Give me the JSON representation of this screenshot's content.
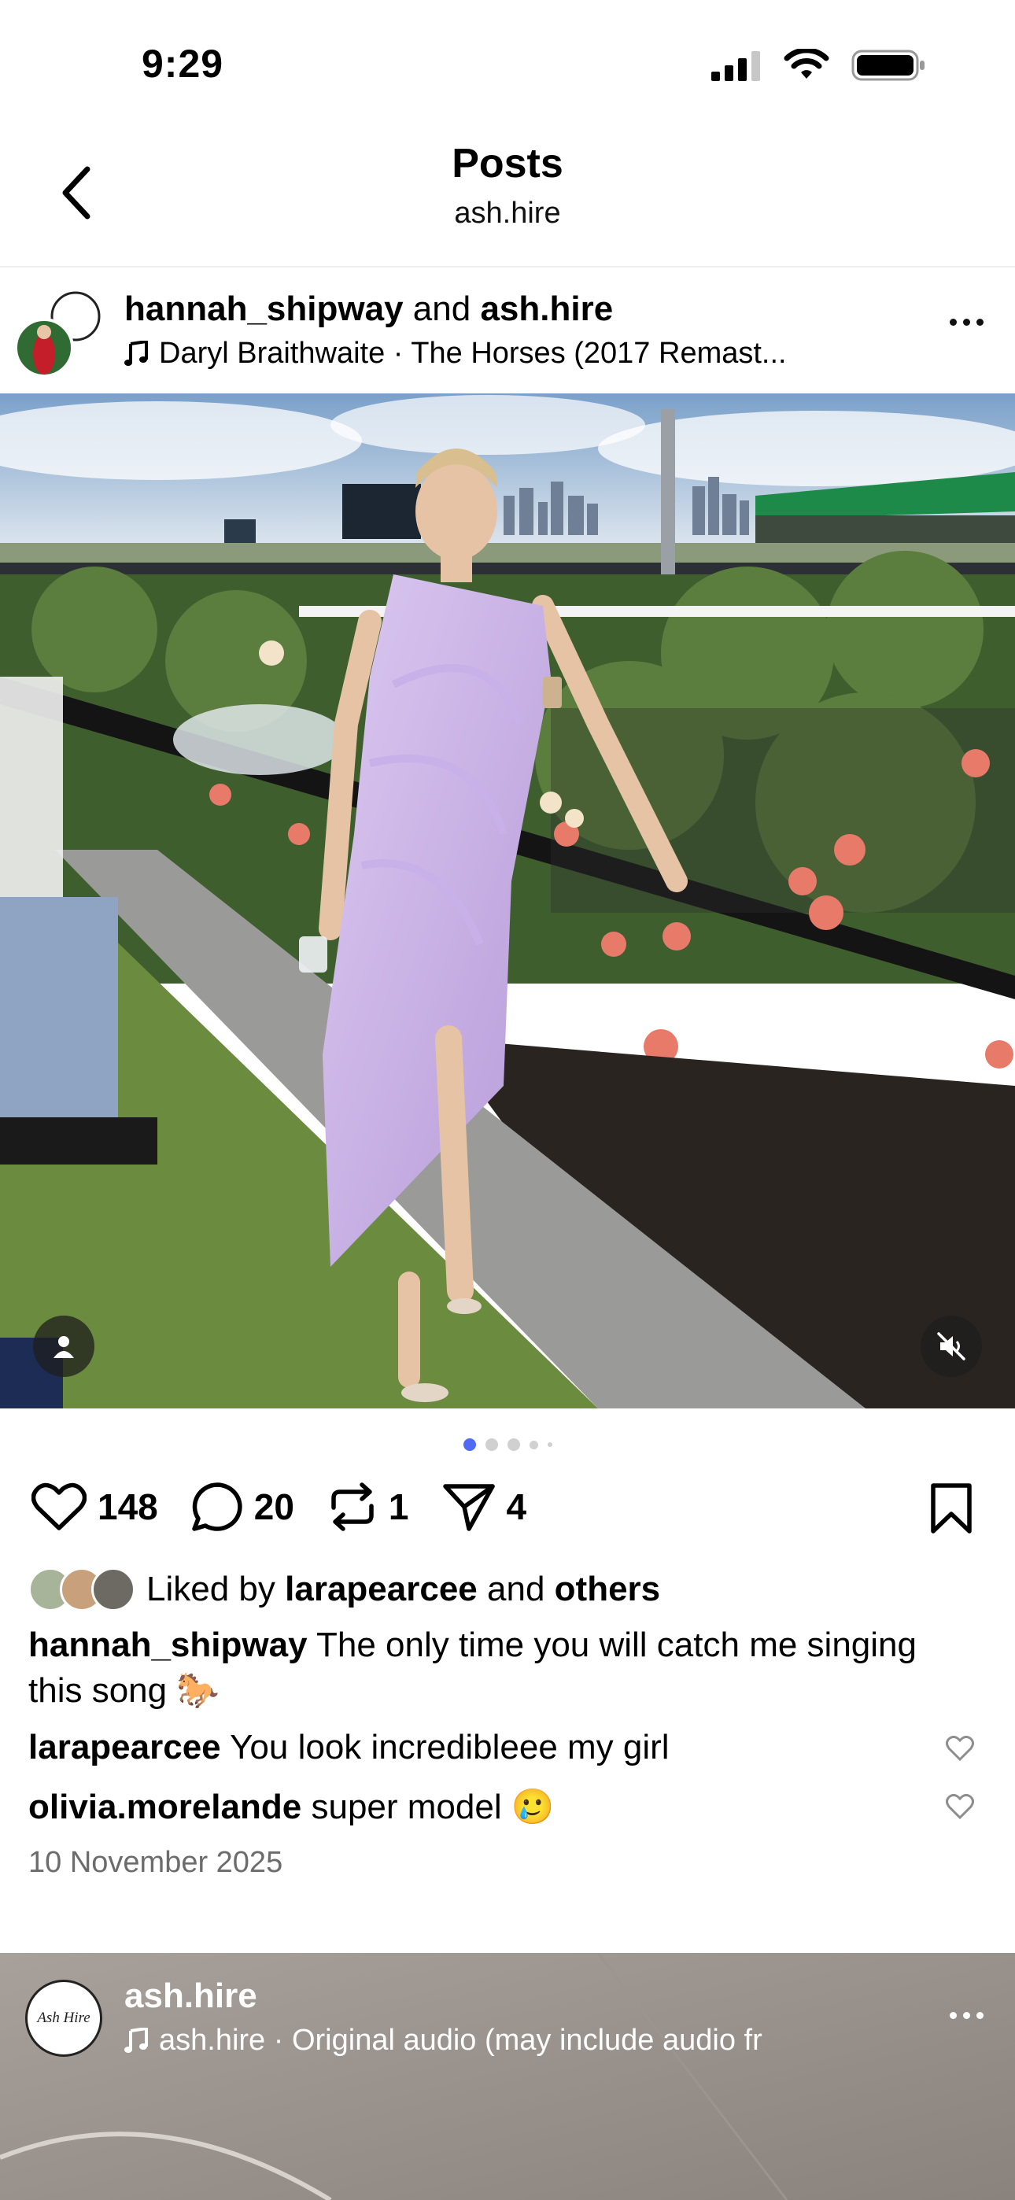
{
  "status": {
    "time": "9:29"
  },
  "nav": {
    "title": "Posts",
    "subtitle": "ash.hire"
  },
  "post": {
    "user1": "hannah_shipway",
    "and_text": "and",
    "user2": "ash.hire",
    "audio": "Daryl Braithwaite · The Horses (2017 Remast...",
    "likes": "148",
    "comments": "20",
    "reposts": "1",
    "shares": "4",
    "liked_by_prefix": "Liked by",
    "liked_by_user": "larapearcee",
    "liked_by_and": "and",
    "liked_by_others": "others",
    "caption_user": "hannah_shipway",
    "caption_text": "The only time you will catch me singing this song 🐎",
    "comments_list": [
      {
        "user": "larapearcee",
        "text": "You look incredibleee my girl"
      },
      {
        "user": "olivia.morelande",
        "text": "super model 🥲"
      }
    ],
    "date": "10 November 2025"
  },
  "next_post": {
    "user": "ash.hire",
    "audio": "ash.hire · Original audio  (may include audio fr",
    "avatar_text": "Ash Hire"
  },
  "colors": {
    "accent": "#3897f0",
    "dot_active": "#4f6bf5",
    "dress": "#c9b3e6"
  }
}
